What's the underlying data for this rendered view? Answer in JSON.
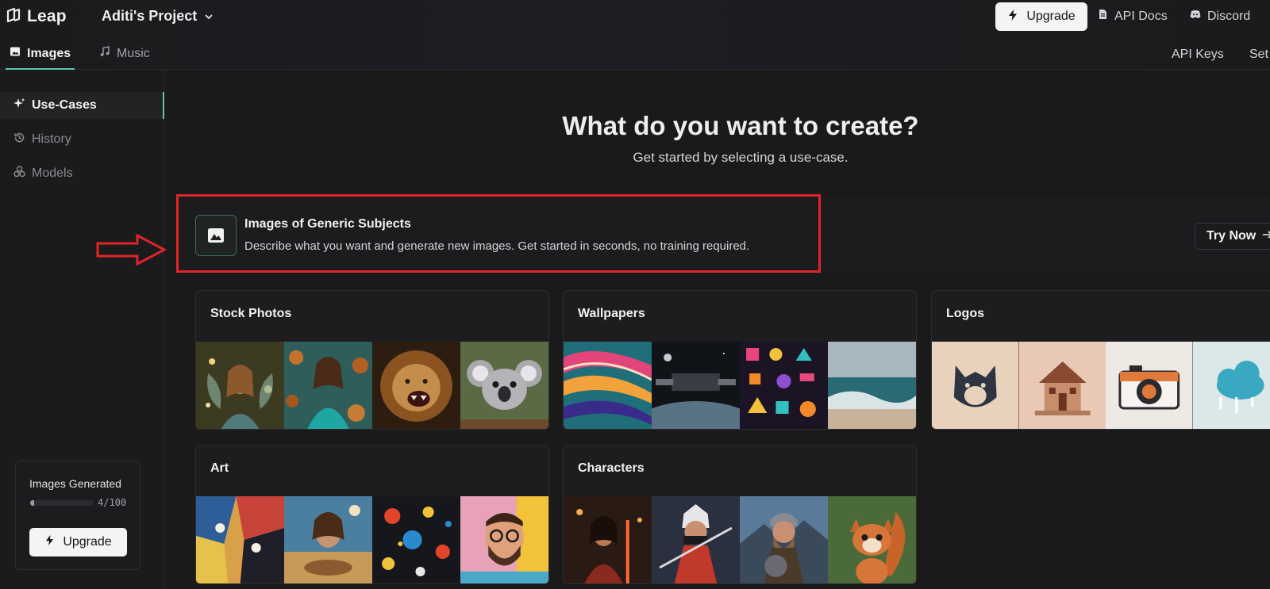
{
  "app": {
    "name": "Leap",
    "project": "Aditi's Project"
  },
  "header": {
    "upgrade_label": "Upgrade",
    "api_docs_label": "API Docs",
    "discord_label": "Discord",
    "tabs": [
      {
        "label": "Images",
        "icon": "image-icon",
        "active": true
      },
      {
        "label": "Music",
        "icon": "music-icon",
        "active": false
      }
    ],
    "right_tabs": [
      "API Keys",
      "Set"
    ]
  },
  "sidebar": {
    "items": [
      {
        "label": "Use-Cases",
        "icon": "sparkles-icon",
        "active": true
      },
      {
        "label": "History",
        "icon": "history-icon",
        "active": false
      },
      {
        "label": "Models",
        "icon": "models-icon",
        "active": false
      }
    ],
    "usage": {
      "title": "Images Generated",
      "count_text": "4/100",
      "fraction": 0.04
    },
    "upgrade_label": "Upgrade"
  },
  "main": {
    "title": "What do you want to create?",
    "subtitle": "Get started by selecting a use-case.",
    "generic": {
      "title": "Images of Generic Subjects",
      "description": "Describe what you want and generate new images. Get started in seconds, no training required.",
      "cta": "Try Now"
    },
    "categories": [
      {
        "title": "Stock Photos",
        "thumbs": [
          "fairy-woman-thumb",
          "woman-teal-dress-thumb",
          "roaring-lion-thumb",
          "koala-thumb"
        ]
      },
      {
        "title": "Wallpapers",
        "thumbs": [
          "abstract-swirl-thumb",
          "space-station-thumb",
          "geometric-pattern-thumb",
          "ocean-waves-thumb"
        ]
      },
      {
        "title": "Logos",
        "thumbs": [
          "wolf-logo-thumb",
          "house-logo-thumb",
          "camera-logo-thumb",
          "cloud-logo-thumb"
        ]
      },
      {
        "title": "Art",
        "thumbs": [
          "cubist-faces-thumb",
          "surreal-woman-thumb",
          "paint-splatter-thumb",
          "pop-art-man-thumb"
        ]
      },
      {
        "title": "Characters",
        "thumbs": [
          "warrior-woman-thumb",
          "ninja-thumb",
          "viking-thumb",
          "squirrel-thumb"
        ]
      }
    ]
  },
  "colors": {
    "accent": "#5ec7b0",
    "highlight": "#e0242c",
    "background": "#1a1a1b"
  }
}
